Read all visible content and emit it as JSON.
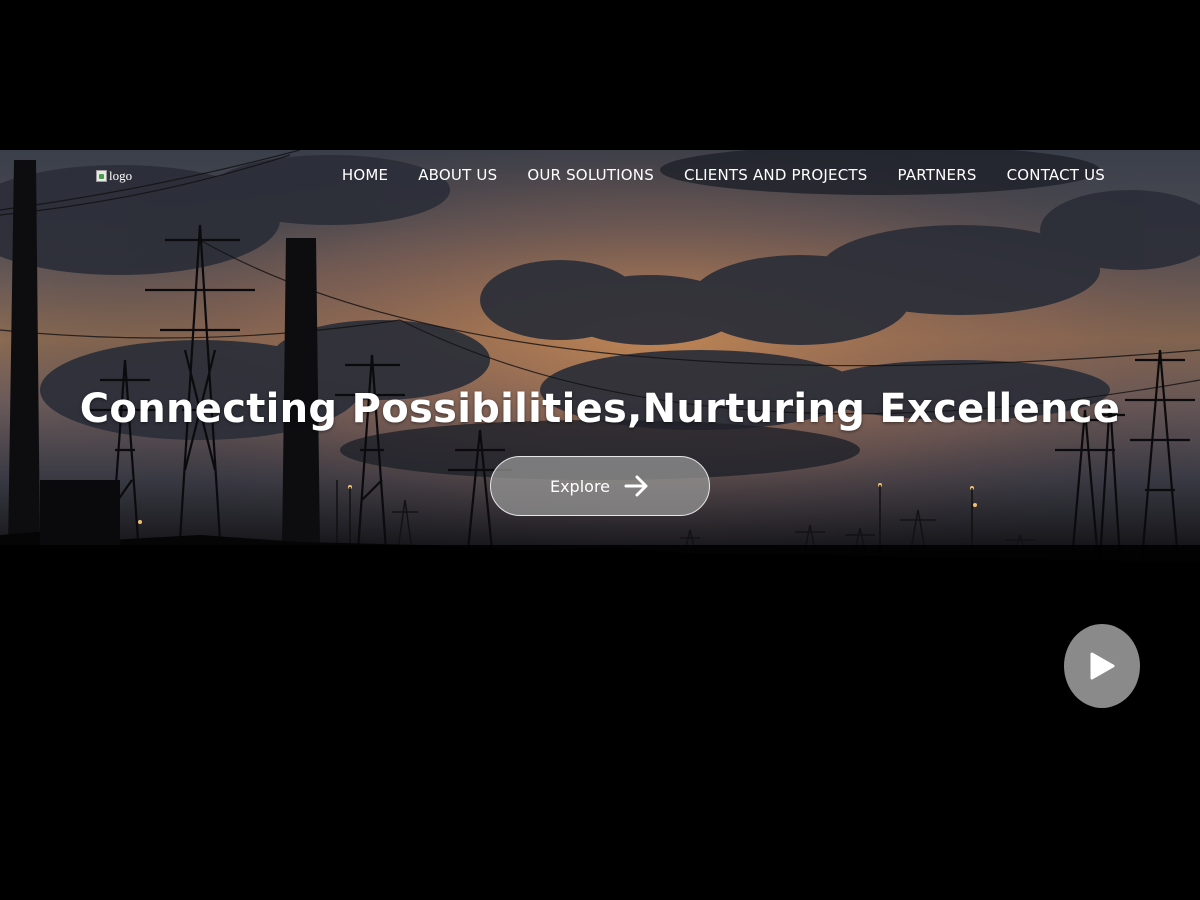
{
  "header": {
    "logo_alt": "logo",
    "nav": [
      {
        "label": "HOME"
      },
      {
        "label": "ABOUT US"
      },
      {
        "label": "OUR SOLUTIONS"
      },
      {
        "label": "CLIENTS AND PROJECTS"
      },
      {
        "label": "PARTNERS"
      },
      {
        "label": "CONTACT US"
      }
    ]
  },
  "hero": {
    "headline": "Connecting Possibilities,Nurturing Excellence",
    "explore_label": "Explore",
    "explore_icon": "arrow-right-icon",
    "background": "sunset sky with power transmission towers"
  },
  "player": {
    "play_icon": "play-icon"
  },
  "colors": {
    "background": "#000000",
    "text": "#ffffff",
    "button_fill": "#969696",
    "play_button": "#8a8a8a"
  }
}
